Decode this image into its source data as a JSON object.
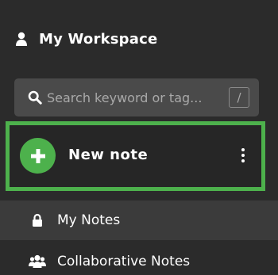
{
  "workspace": {
    "title": "My Workspace",
    "icon": "user-icon"
  },
  "search": {
    "placeholder": "Search keyword or tag...",
    "value": "",
    "shortcut": "/",
    "icon": "search-icon"
  },
  "new_note": {
    "label": "New note",
    "icon": "plus-icon",
    "menu_icon": "kebab-menu-icon",
    "highlight_color": "#4db14c"
  },
  "nav": {
    "items": [
      {
        "label": "My Notes",
        "icon": "lock-icon"
      },
      {
        "label": "Collaborative Notes",
        "icon": "users-icon"
      }
    ]
  },
  "colors": {
    "background": "#2b2b2b",
    "accent": "#4db14c",
    "search_bg": "#4a4a4a",
    "active_item_bg": "#3b3b3b"
  }
}
